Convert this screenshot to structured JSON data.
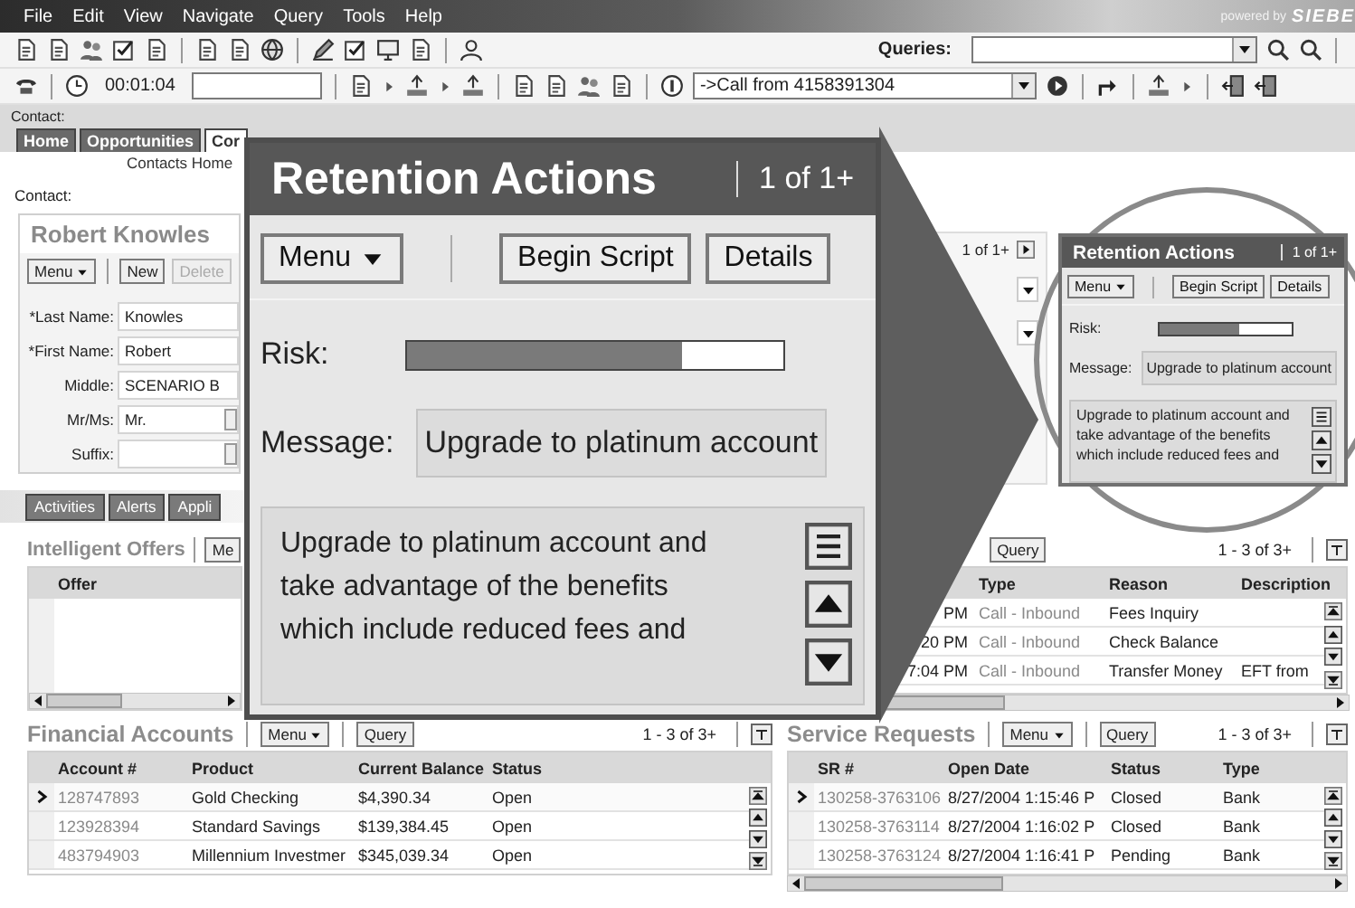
{
  "menu_bar": {
    "items": [
      "File",
      "Edit",
      "View",
      "Navigate",
      "Query",
      "Tools",
      "Help"
    ],
    "brand_note": "powered by",
    "brand": "SIEBE"
  },
  "query_bar": {
    "label": "Queries:"
  },
  "call_bar": {
    "timer": "00:01:04",
    "call": "->Call from 4158391304"
  },
  "screen_label": "Contact:",
  "tabs": [
    {
      "label": "Home",
      "selected": false
    },
    {
      "label": "Opportunities",
      "selected": false
    },
    {
      "label": "Cor",
      "selected": true
    }
  ],
  "sub_link": "Contacts Home",
  "contact_label": "Contact:",
  "contact_form": {
    "title": "Robert Knowles",
    "buttons": [
      {
        "label": "Menu",
        "kind": "menu",
        "disabled": false
      },
      {
        "label": "New",
        "kind": "plain",
        "disabled": false
      },
      {
        "label": "Delete",
        "kind": "plain",
        "disabled": true
      }
    ],
    "fields": [
      {
        "label": "*Last Name:",
        "value": "Knowles",
        "kind": "text"
      },
      {
        "label": "*First Name:",
        "value": "Robert",
        "kind": "text"
      },
      {
        "label": "Middle:",
        "value": "SCENARIO B",
        "kind": "text"
      },
      {
        "label": "Mr/Ms:",
        "value": "Mr.",
        "kind": "picklist"
      },
      {
        "label": "Suffix:",
        "kind": "picklist"
      }
    ]
  },
  "detail_pager": "1 of 1+",
  "view_tabs": [
    {
      "label": "Activities",
      "selected": false
    },
    {
      "label": "Alerts",
      "selected": false
    },
    {
      "label": "Appli",
      "selected": false
    }
  ],
  "retention_zoom": {
    "title": "Retention Actions",
    "pager": "1 of 1+",
    "menu": "Menu",
    "buttons": [
      "Begin Script",
      "Details"
    ],
    "risk": {
      "label": "Risk:",
      "level": 0.73
    },
    "message_label": "Message:",
    "message": "Upgrade to platinum account",
    "body": "Upgrade to platinum account and take advantage of the benefits which include reduced fees and"
  },
  "retention_applet": {
    "title": "Retention Actions",
    "pager": "1 of 1+",
    "menu": "Menu",
    "buttons": [
      "Begin Script",
      "Details"
    ],
    "risk": {
      "label": "Risk:",
      "level": 0.6
    },
    "message_label": "Message:",
    "message": "Upgrade to platinum account",
    "body": "Upgrade to platinum account and take advantage of the benefits which include reduced fees and"
  },
  "intelligent_offers": {
    "title": "Intelligent Offers",
    "menu": "Me",
    "columns": [
      {
        "label": "Offer"
      }
    ]
  },
  "activities": {
    "query": "Query",
    "count": "1 - 3 of 3+",
    "columns": [
      {
        "kind": "time"
      },
      {
        "label": "Type",
        "kind": "link"
      },
      {
        "label": "Reason",
        "kind": "text"
      },
      {
        "label": "Description",
        "kind": "text"
      }
    ],
    "rows": [
      {
        "cells": [
          "PM",
          "Call - Inbound",
          "Fees Inquiry"
        ]
      },
      {
        "cells": [
          "20 PM",
          "Call - Inbound",
          "Check Balance"
        ]
      },
      {
        "cells": [
          "7:04 PM",
          "Call - Inbound",
          "Transfer Money",
          "EFT from"
        ]
      }
    ]
  },
  "financial_accounts": {
    "title": "Financial Accounts",
    "menu": "Menu",
    "query": "Query",
    "count": "1 - 3 of 3+",
    "columns": [
      {
        "label": "Account #",
        "kind": "link"
      },
      {
        "label": "Product",
        "kind": "text"
      },
      {
        "label": "Current Balance",
        "kind": "text"
      },
      {
        "label": "Status",
        "kind": "text"
      }
    ],
    "rows": [
      {
        "selected": true,
        "cells": [
          "128747893",
          "Gold Checking",
          "$4,390.34",
          "Open"
        ]
      },
      {
        "selected": false,
        "cells": [
          "123928394",
          "Standard Savings",
          "$139,384.45",
          "Open"
        ]
      },
      {
        "selected": false,
        "cells": [
          "483794903",
          "Millennium Investmer",
          "$345,039.34",
          "Open"
        ]
      }
    ]
  },
  "service_requests": {
    "title": "Service Requests",
    "menu": "Menu",
    "query": "Query",
    "count": "1 - 3 of 3+",
    "columns": [
      {
        "label": "SR #",
        "kind": "link"
      },
      {
        "label": "Open Date",
        "kind": "text"
      },
      {
        "label": "Status",
        "kind": "text"
      },
      {
        "label": "Type",
        "kind": "text"
      }
    ],
    "rows": [
      {
        "selected": true,
        "cells": [
          "130258-3763106",
          "8/27/2004 1:15:46 P",
          "Closed",
          "Bank"
        ]
      },
      {
        "selected": false,
        "cells": [
          "130258-3763114",
          "8/27/2004 1:16:02 P",
          "Closed",
          "Bank"
        ]
      },
      {
        "selected": false,
        "cells": [
          "130258-3763124",
          "8/27/2004 1:16:41 P",
          "Pending",
          "Bank"
        ]
      }
    ]
  }
}
